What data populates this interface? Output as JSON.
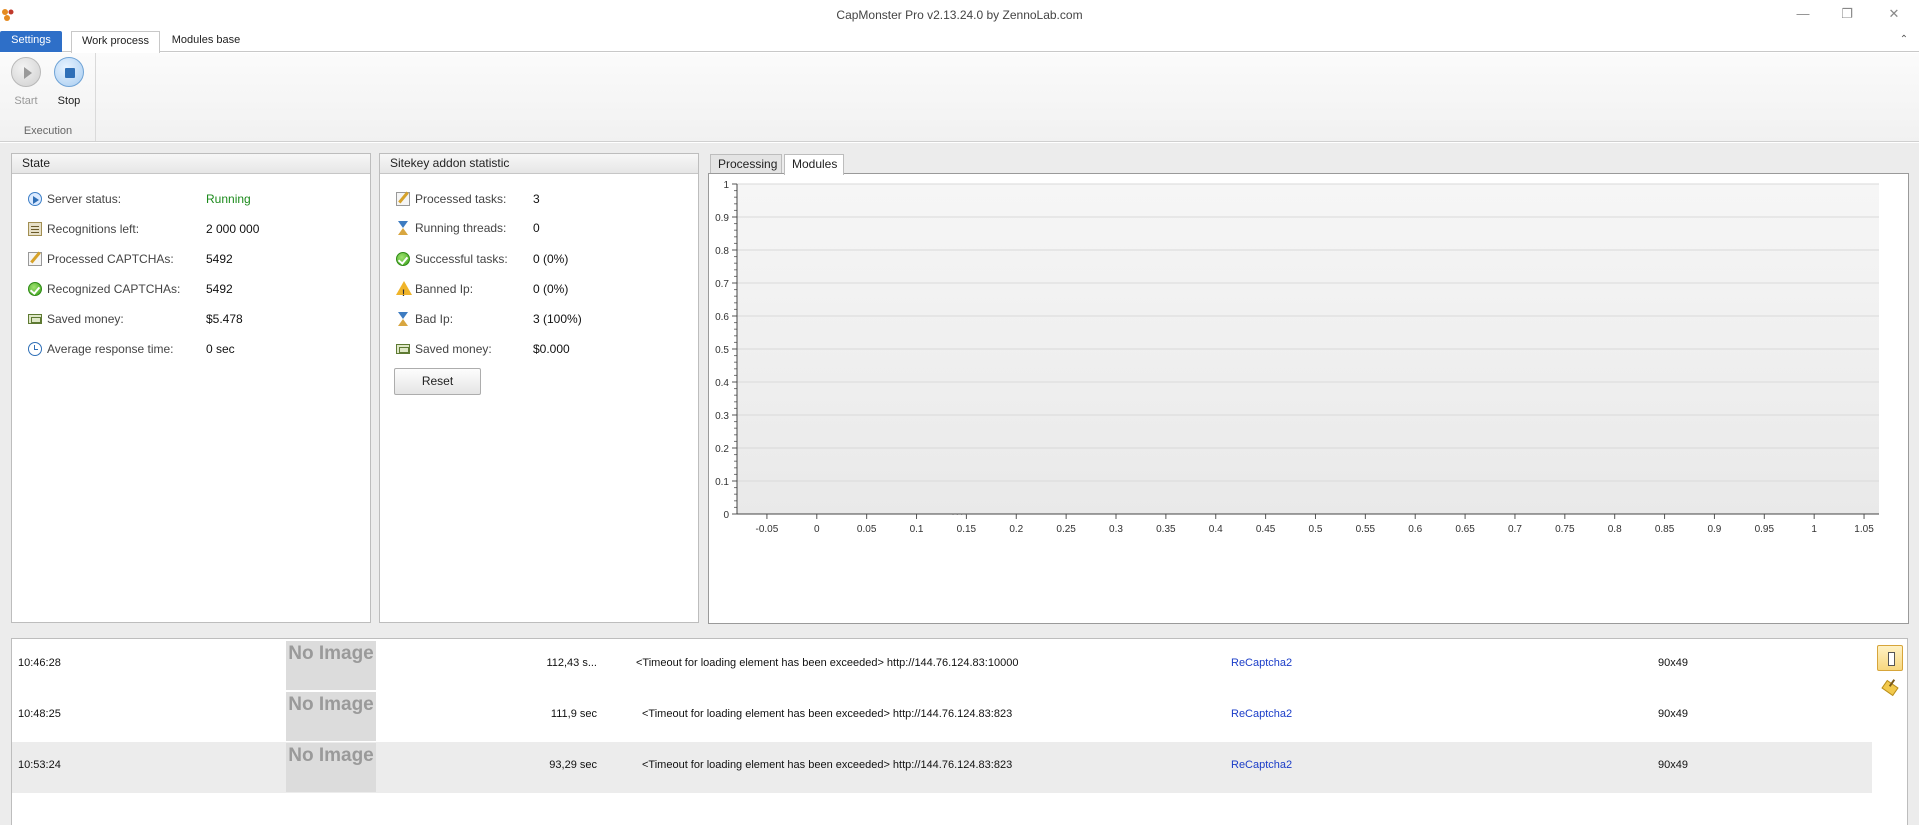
{
  "window": {
    "title": "CapMonster Pro v2.13.24.0 by ZennoLab.com",
    "minimize_glyph": "—",
    "restore_glyph": "❐",
    "close_glyph": "✕"
  },
  "ribbon": {
    "tabs": [
      {
        "label": "Settings"
      },
      {
        "label": "Work process"
      },
      {
        "label": "Modules base"
      }
    ],
    "collapse_glyph": "⌃",
    "execution_group": {
      "label": "Execution",
      "start_label": "Start",
      "stop_label": "Stop"
    }
  },
  "state": {
    "title": "State",
    "rows": [
      {
        "label": "Server status:",
        "value": "Running",
        "icon": "play-status-icon"
      },
      {
        "label": "Recognitions  left:",
        "value": "2 000 000",
        "icon": "recognitions-icon"
      },
      {
        "label": "Processed CAPTCHAs:",
        "value": "5492",
        "icon": "processed-icon"
      },
      {
        "label": "Recognized CAPTCHAs:",
        "value": "5492",
        "icon": "check-icon"
      },
      {
        "label": "Saved money:",
        "value": "$5.478",
        "icon": "money-icon"
      },
      {
        "label": "Average response time:",
        "value": "0 sec",
        "icon": "clock-icon"
      }
    ]
  },
  "sitekey": {
    "title": "Sitekey addon statistic",
    "rows": [
      {
        "label": "Processed tasks:",
        "value": "3",
        "icon": "processed-icon"
      },
      {
        "label": "Running threads:",
        "value": "0",
        "icon": "hourglass-icon"
      },
      {
        "label": "Successful tasks:",
        "value": "0 (0%)",
        "icon": "check-icon"
      },
      {
        "label": "Banned Ip:",
        "value": "0 (0%)",
        "icon": "warning-icon"
      },
      {
        "label": "Bad Ip:",
        "value": "3 (100%)",
        "icon": "hourglass-icon"
      },
      {
        "label": "Saved money:",
        "value": "$0.000",
        "icon": "money-icon"
      }
    ],
    "reset_label": "Reset"
  },
  "chart_tabs": [
    {
      "label": "Processing"
    },
    {
      "label": "Modules"
    }
  ],
  "chart_data": {
    "type": "line",
    "title": "",
    "xlabel": "",
    "ylabel": "",
    "xlim": [
      -0.08,
      1.065
    ],
    "ylim": [
      0,
      1
    ],
    "x_ticks": [
      "-0.05",
      "0",
      "0.05",
      "0.1",
      "0.15",
      "0.2",
      "0.25",
      "0.3",
      "0.35",
      "0.4",
      "0.45",
      "0.5",
      "0.55",
      "0.6",
      "0.65",
      "0.7",
      "0.75",
      "0.8",
      "0.85",
      "0.9",
      "0.95",
      "1",
      "1.05"
    ],
    "y_ticks": [
      "0",
      "0.1",
      "0.2",
      "0.3",
      "0.4",
      "0.5",
      "0.6",
      "0.7",
      "0.8",
      "0.9",
      "1"
    ],
    "series": [],
    "grid": true
  },
  "splitter_glyph": "····",
  "log": {
    "rows": [
      {
        "time": "10:46:28",
        "image": "No Image",
        "duration": "112,43 s...",
        "message": "<Timeout for loading element has been exceeded>  http://144.76.124.83:10000",
        "type": "ReCaptcha2",
        "size": "90x49"
      },
      {
        "time": "10:48:25",
        "image": "No Image",
        "duration": "111,9 sec",
        "message": "<Timeout for loading element has been exceeded>  http://144.76.124.83:823",
        "type": "ReCaptcha2",
        "size": "90x49"
      },
      {
        "time": "10:53:24",
        "image": "No Image",
        "duration": "93,29 sec",
        "message": "<Timeout for loading element has been exceeded>  http://144.76.124.83:823",
        "type": "ReCaptcha2",
        "size": "90x49"
      }
    ]
  },
  "colors": {
    "accent": "#2e6fc8",
    "running": "#1b8a1b",
    "link": "#1a3cc8"
  }
}
